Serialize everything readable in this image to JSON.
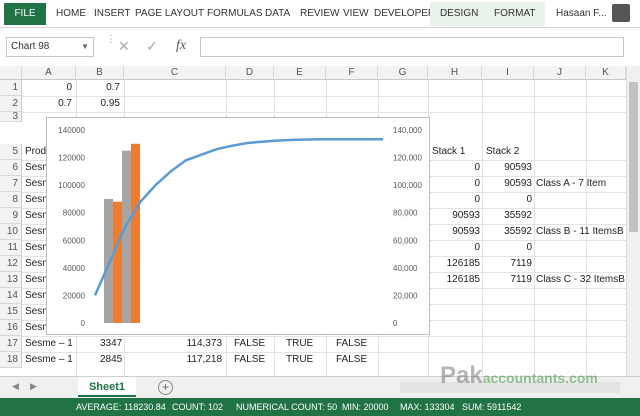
{
  "ribbon": {
    "file": "FILE",
    "tabs": [
      "HOME",
      "INSERT",
      "PAGE LAYOUT",
      "FORMULAS",
      "DATA",
      "REVIEW",
      "VIEW",
      "DEVELOPER",
      "DESIGN",
      "FORMAT"
    ],
    "user": "Hasaan F...",
    "accent": "#217346"
  },
  "formula_bar": {
    "name_box": "Chart 98",
    "fx": "fx",
    "value": ""
  },
  "columns": [
    "A",
    "B",
    "C",
    "D",
    "E",
    "F",
    "G",
    "H",
    "I",
    "J",
    "K"
  ],
  "rows": [
    "1",
    "2",
    "3",
    "5",
    "6",
    "7",
    "8",
    "9",
    "10",
    "11",
    "12",
    "13",
    "14",
    "15",
    "16",
    "17",
    "18"
  ],
  "cells": {
    "a1": "0",
    "b1": "0.7",
    "a2": "0.7",
    "b2": "0.95",
    "a5": "Prod",
    "h5": "Stack 1",
    "i5": "Stack 2",
    "a6": "Sesm",
    "h6": "0",
    "i6": "90593",
    "a7": "Sesm",
    "h7": "0",
    "i7": "90593",
    "j7": "Class A - 7 Item",
    "a8": "Sesm",
    "h8": "0",
    "i8": "0",
    "a9": "Sesm",
    "h9": "90593",
    "i9": "35592",
    "a10": "Sesm",
    "h10": "90593",
    "i10": "35592",
    "j10": "Class B - 11 ItemsB",
    "a11": "Sesm",
    "h11": "0",
    "i11": "0",
    "a12": "Sesm",
    "h12": "126185",
    "i12": "7119",
    "a13": "Sesm",
    "h13": "126185",
    "i13": "7119",
    "j13": "Class C - 32 ItemsB",
    "a14": "Sesm",
    "a15": "Sesm",
    "a16": "Sesm",
    "a17": "Sesme – 1",
    "b17": "3347",
    "c17": "114,373",
    "d17": "FALSE",
    "e17": "TRUE",
    "f17": "FALSE",
    "a18": "Sesme – 1",
    "b18": "2845",
    "c18": "117,218",
    "d18": "FALSE",
    "e18": "TRUE",
    "f18": "FALSE"
  },
  "chart_data": {
    "type": "bar",
    "left_axis": {
      "ticks": [
        "140000",
        "120000",
        "100000",
        "80000",
        "60000",
        "40000",
        "20000",
        "0"
      ],
      "ylim": [
        0,
        140000
      ]
    },
    "right_axis": {
      "ticks": [
        "140,000",
        "120,000",
        "100,000",
        "80,000",
        "60,000",
        "40,000",
        "20,000",
        "0"
      ],
      "ylim": [
        0,
        140000
      ]
    },
    "series": [
      {
        "color": "#a5a5a5",
        "values": [
          0,
          90000,
          0,
          125000,
          0
        ]
      },
      {
        "color": "#ed7d31",
        "values": [
          0,
          0,
          88000,
          0,
          130000
        ]
      }
    ],
    "line": {
      "color": "#5b9bd5",
      "values": [
        20000,
        45000,
        70000,
        88000,
        100000,
        110000,
        118000,
        122000,
        126000,
        128500,
        130500,
        131500,
        132300,
        132800,
        133100,
        133250,
        133300,
        133304,
        133304,
        133304
      ]
    }
  },
  "sheet_tab": "Sheet1",
  "add_sheet": "+",
  "status": {
    "average": "AVERAGE: 118230.84",
    "count": "COUNT: 102",
    "numerical_count": "NUMERICAL COUNT: 50",
    "min": "MIN: 20000",
    "max": "MAX: 133304",
    "sum": "SUM: 5911542"
  },
  "watermark": {
    "main": "Pak",
    "sub": "accountants.com"
  }
}
